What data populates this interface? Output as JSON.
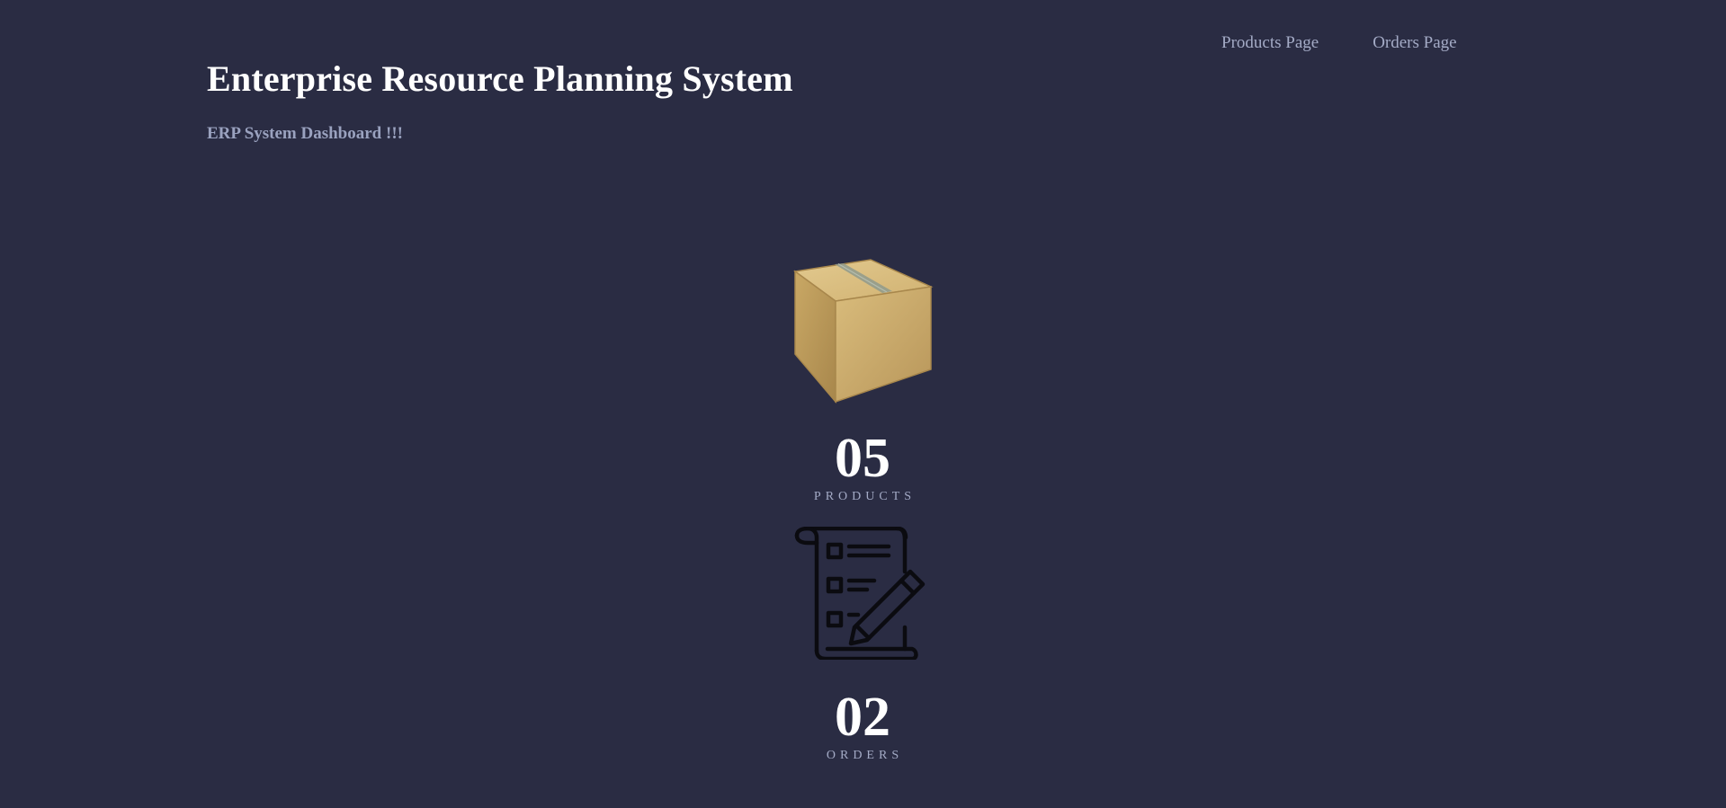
{
  "nav": {
    "products_label": "Products Page",
    "orders_label": "Orders Page"
  },
  "header": {
    "title": "Enterprise Resource Planning System",
    "subtitle": "ERP System Dashboard !!!"
  },
  "stats": {
    "products": {
      "icon": "cardboard-box-icon",
      "count": "05",
      "label": "PRODUCTS"
    },
    "orders": {
      "icon": "checklist-pencil-icon",
      "count": "02",
      "label": "ORDERS"
    }
  },
  "colors": {
    "background": "#2a2c43",
    "muted_text": "#a4abc6",
    "heading": "#ffffff",
    "box": "#c9a865"
  }
}
